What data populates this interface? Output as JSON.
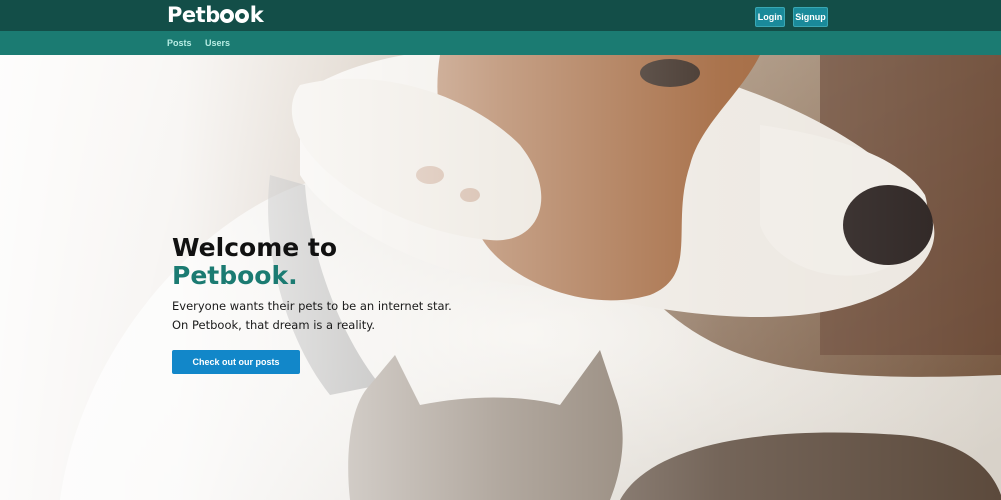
{
  "header": {
    "logo_prefix": "P",
    "logo_mid": "etb",
    "logo_suffix": "k",
    "login_label": "Login",
    "signup_label": "Signup"
  },
  "nav": {
    "items": [
      {
        "label": "Posts"
      },
      {
        "label": "Users"
      }
    ]
  },
  "hero": {
    "title_line1": "Welcome to",
    "title_line2": "Petbook.",
    "tagline": "Everyone wants their pets to be an internet star. On Petbook, that dream is a reality.",
    "cta_label": "Check out our posts",
    "image_subject": "dog-and-cat-photo"
  },
  "colors": {
    "topbar": "#134e48",
    "subnav": "#1b7b72",
    "brand": "#1b7b72",
    "cta": "#1287c9",
    "top_buttons": "#1a8a9a"
  }
}
